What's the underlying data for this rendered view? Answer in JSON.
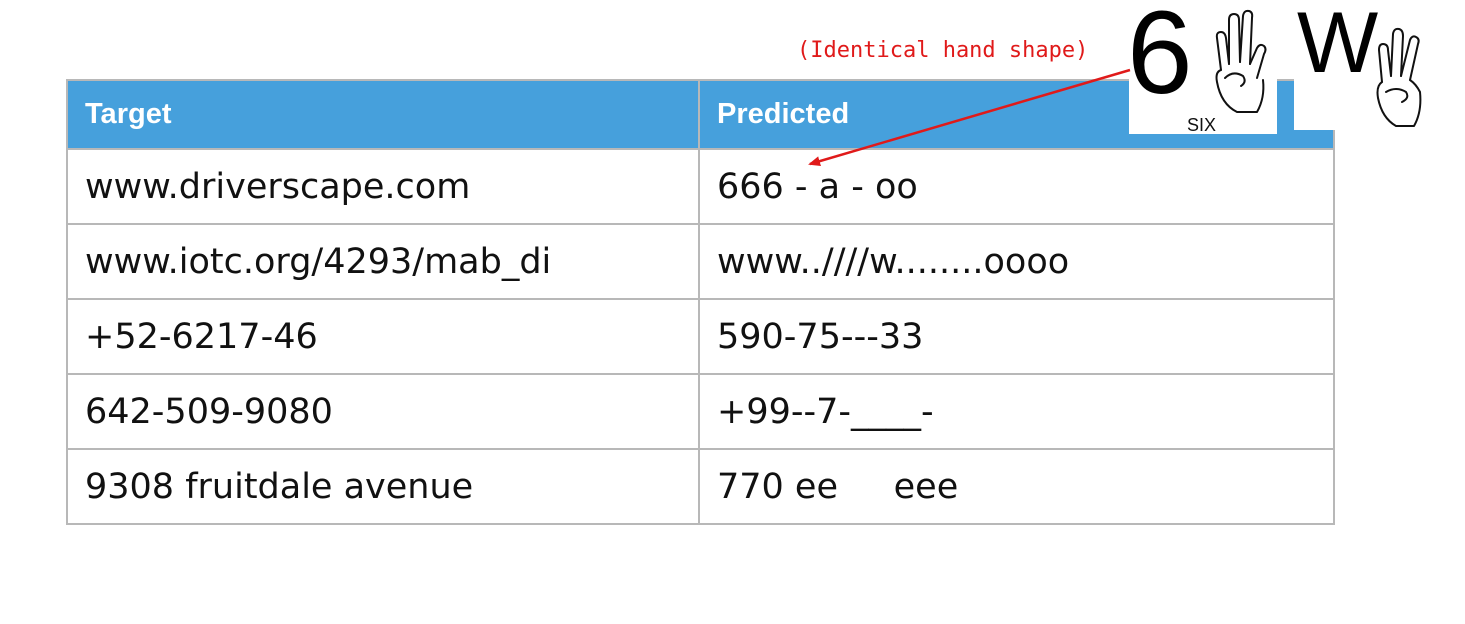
{
  "table": {
    "headers": [
      "Target",
      "Predicted"
    ],
    "rows": [
      [
        "www.driverscape.com",
        "666 - a - oo"
      ],
      [
        "www.iotc.org/4293/mab_di",
        "www..////w........oooo"
      ],
      [
        "+52-6217-46",
        "590-75---33"
      ],
      [
        "642-509-9080",
        "+99--7-____-"
      ],
      [
        "9308 fruitdale avenue",
        "770 ee     eee"
      ]
    ]
  },
  "annotation": {
    "text": "(Identical hand shape)",
    "color": "#e01a1a"
  },
  "signs": {
    "six_glyph": "6",
    "six_label": "SIX",
    "w_glyph": "W"
  },
  "colors": {
    "header_bg": "#46a0dc",
    "border": "#b8b8b8"
  }
}
